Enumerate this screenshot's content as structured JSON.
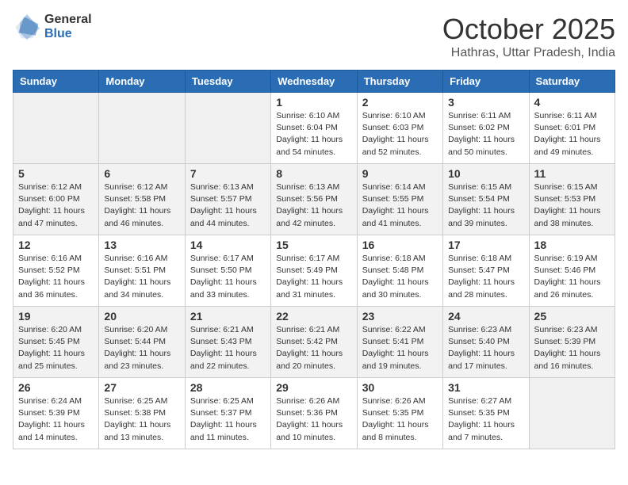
{
  "header": {
    "logo_general": "General",
    "logo_blue": "Blue",
    "month": "October 2025",
    "location": "Hathras, Uttar Pradesh, India"
  },
  "weekdays": [
    "Sunday",
    "Monday",
    "Tuesday",
    "Wednesday",
    "Thursday",
    "Friday",
    "Saturday"
  ],
  "weeks": [
    [
      {
        "day": "",
        "sunrise": "",
        "sunset": "",
        "daylight": ""
      },
      {
        "day": "",
        "sunrise": "",
        "sunset": "",
        "daylight": ""
      },
      {
        "day": "",
        "sunrise": "",
        "sunset": "",
        "daylight": ""
      },
      {
        "day": "1",
        "sunrise": "Sunrise: 6:10 AM",
        "sunset": "Sunset: 6:04 PM",
        "daylight": "Daylight: 11 hours and 54 minutes."
      },
      {
        "day": "2",
        "sunrise": "Sunrise: 6:10 AM",
        "sunset": "Sunset: 6:03 PM",
        "daylight": "Daylight: 11 hours and 52 minutes."
      },
      {
        "day": "3",
        "sunrise": "Sunrise: 6:11 AM",
        "sunset": "Sunset: 6:02 PM",
        "daylight": "Daylight: 11 hours and 50 minutes."
      },
      {
        "day": "4",
        "sunrise": "Sunrise: 6:11 AM",
        "sunset": "Sunset: 6:01 PM",
        "daylight": "Daylight: 11 hours and 49 minutes."
      }
    ],
    [
      {
        "day": "5",
        "sunrise": "Sunrise: 6:12 AM",
        "sunset": "Sunset: 6:00 PM",
        "daylight": "Daylight: 11 hours and 47 minutes."
      },
      {
        "day": "6",
        "sunrise": "Sunrise: 6:12 AM",
        "sunset": "Sunset: 5:58 PM",
        "daylight": "Daylight: 11 hours and 46 minutes."
      },
      {
        "day": "7",
        "sunrise": "Sunrise: 6:13 AM",
        "sunset": "Sunset: 5:57 PM",
        "daylight": "Daylight: 11 hours and 44 minutes."
      },
      {
        "day": "8",
        "sunrise": "Sunrise: 6:13 AM",
        "sunset": "Sunset: 5:56 PM",
        "daylight": "Daylight: 11 hours and 42 minutes."
      },
      {
        "day": "9",
        "sunrise": "Sunrise: 6:14 AM",
        "sunset": "Sunset: 5:55 PM",
        "daylight": "Daylight: 11 hours and 41 minutes."
      },
      {
        "day": "10",
        "sunrise": "Sunrise: 6:15 AM",
        "sunset": "Sunset: 5:54 PM",
        "daylight": "Daylight: 11 hours and 39 minutes."
      },
      {
        "day": "11",
        "sunrise": "Sunrise: 6:15 AM",
        "sunset": "Sunset: 5:53 PM",
        "daylight": "Daylight: 11 hours and 38 minutes."
      }
    ],
    [
      {
        "day": "12",
        "sunrise": "Sunrise: 6:16 AM",
        "sunset": "Sunset: 5:52 PM",
        "daylight": "Daylight: 11 hours and 36 minutes."
      },
      {
        "day": "13",
        "sunrise": "Sunrise: 6:16 AM",
        "sunset": "Sunset: 5:51 PM",
        "daylight": "Daylight: 11 hours and 34 minutes."
      },
      {
        "day": "14",
        "sunrise": "Sunrise: 6:17 AM",
        "sunset": "Sunset: 5:50 PM",
        "daylight": "Daylight: 11 hours and 33 minutes."
      },
      {
        "day": "15",
        "sunrise": "Sunrise: 6:17 AM",
        "sunset": "Sunset: 5:49 PM",
        "daylight": "Daylight: 11 hours and 31 minutes."
      },
      {
        "day": "16",
        "sunrise": "Sunrise: 6:18 AM",
        "sunset": "Sunset: 5:48 PM",
        "daylight": "Daylight: 11 hours and 30 minutes."
      },
      {
        "day": "17",
        "sunrise": "Sunrise: 6:18 AM",
        "sunset": "Sunset: 5:47 PM",
        "daylight": "Daylight: 11 hours and 28 minutes."
      },
      {
        "day": "18",
        "sunrise": "Sunrise: 6:19 AM",
        "sunset": "Sunset: 5:46 PM",
        "daylight": "Daylight: 11 hours and 26 minutes."
      }
    ],
    [
      {
        "day": "19",
        "sunrise": "Sunrise: 6:20 AM",
        "sunset": "Sunset: 5:45 PM",
        "daylight": "Daylight: 11 hours and 25 minutes."
      },
      {
        "day": "20",
        "sunrise": "Sunrise: 6:20 AM",
        "sunset": "Sunset: 5:44 PM",
        "daylight": "Daylight: 11 hours and 23 minutes."
      },
      {
        "day": "21",
        "sunrise": "Sunrise: 6:21 AM",
        "sunset": "Sunset: 5:43 PM",
        "daylight": "Daylight: 11 hours and 22 minutes."
      },
      {
        "day": "22",
        "sunrise": "Sunrise: 6:21 AM",
        "sunset": "Sunset: 5:42 PM",
        "daylight": "Daylight: 11 hours and 20 minutes."
      },
      {
        "day": "23",
        "sunrise": "Sunrise: 6:22 AM",
        "sunset": "Sunset: 5:41 PM",
        "daylight": "Daylight: 11 hours and 19 minutes."
      },
      {
        "day": "24",
        "sunrise": "Sunrise: 6:23 AM",
        "sunset": "Sunset: 5:40 PM",
        "daylight": "Daylight: 11 hours and 17 minutes."
      },
      {
        "day": "25",
        "sunrise": "Sunrise: 6:23 AM",
        "sunset": "Sunset: 5:39 PM",
        "daylight": "Daylight: 11 hours and 16 minutes."
      }
    ],
    [
      {
        "day": "26",
        "sunrise": "Sunrise: 6:24 AM",
        "sunset": "Sunset: 5:39 PM",
        "daylight": "Daylight: 11 hours and 14 minutes."
      },
      {
        "day": "27",
        "sunrise": "Sunrise: 6:25 AM",
        "sunset": "Sunset: 5:38 PM",
        "daylight": "Daylight: 11 hours and 13 minutes."
      },
      {
        "day": "28",
        "sunrise": "Sunrise: 6:25 AM",
        "sunset": "Sunset: 5:37 PM",
        "daylight": "Daylight: 11 hours and 11 minutes."
      },
      {
        "day": "29",
        "sunrise": "Sunrise: 6:26 AM",
        "sunset": "Sunset: 5:36 PM",
        "daylight": "Daylight: 11 hours and 10 minutes."
      },
      {
        "day": "30",
        "sunrise": "Sunrise: 6:26 AM",
        "sunset": "Sunset: 5:35 PM",
        "daylight": "Daylight: 11 hours and 8 minutes."
      },
      {
        "day": "31",
        "sunrise": "Sunrise: 6:27 AM",
        "sunset": "Sunset: 5:35 PM",
        "daylight": "Daylight: 11 hours and 7 minutes."
      },
      {
        "day": "",
        "sunrise": "",
        "sunset": "",
        "daylight": ""
      }
    ]
  ]
}
